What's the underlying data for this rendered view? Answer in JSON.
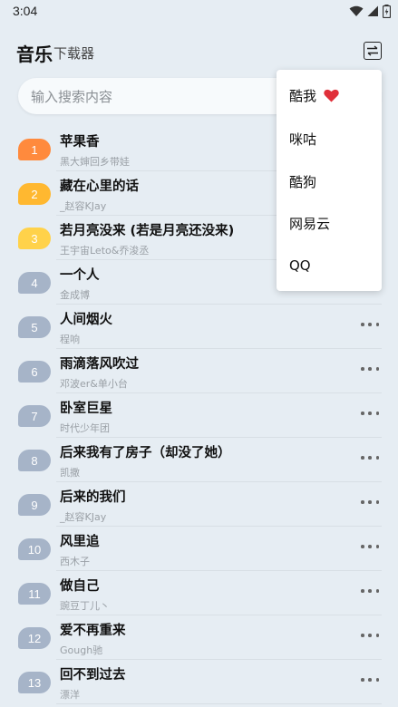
{
  "status_bar": {
    "time": "3:04"
  },
  "header": {
    "title": "音乐",
    "subtitle": "下载器",
    "switch_icon": "swap-icon"
  },
  "search": {
    "placeholder": "输入搜索内容"
  },
  "songs": [
    {
      "rank": "1",
      "title": "苹果香",
      "artist": "黑大婶回乡带娃",
      "color": "#ff8a3d"
    },
    {
      "rank": "2",
      "title": "藏在心里的话",
      "artist": "_赵容KJay",
      "color": "#ffb830"
    },
    {
      "rank": "3",
      "title": "若月亮没来 (若是月亮还没来)",
      "artist": "王宇宙Leto&乔浚丞",
      "color": "#ffd24a"
    },
    {
      "rank": "4",
      "title": "一个人",
      "artist": "金成博",
      "color": "#a6b4c8"
    },
    {
      "rank": "5",
      "title": "人间烟火",
      "artist": "程响",
      "color": "#a6b4c8"
    },
    {
      "rank": "6",
      "title": "雨滴落风吹过",
      "artist": "邓波er&单小台",
      "color": "#a6b4c8"
    },
    {
      "rank": "7",
      "title": "卧室巨星",
      "artist": "时代少年团",
      "color": "#a6b4c8"
    },
    {
      "rank": "8",
      "title": "后来我有了房子（却没了她）",
      "artist": "凯撒",
      "color": "#a6b4c8"
    },
    {
      "rank": "9",
      "title": "后来的我们",
      "artist": "_赵容KJay",
      "color": "#a6b4c8"
    },
    {
      "rank": "10",
      "title": "风里追",
      "artist": "西木子",
      "color": "#a6b4c8"
    },
    {
      "rank": "11",
      "title": "做自己",
      "artist": "豌豆丁儿丶",
      "color": "#a6b4c8"
    },
    {
      "rank": "12",
      "title": "爱不再重来",
      "artist": "Gough驰",
      "color": "#a6b4c8"
    },
    {
      "rank": "13",
      "title": "回不到过去",
      "artist": "漂洋",
      "color": "#a6b4c8"
    }
  ],
  "source_menu": {
    "items": [
      "酷我",
      "咪咕",
      "酷狗",
      "网易云",
      "QQ"
    ],
    "selected_marker": "heart-icon",
    "heart_color": "#e0303a"
  }
}
